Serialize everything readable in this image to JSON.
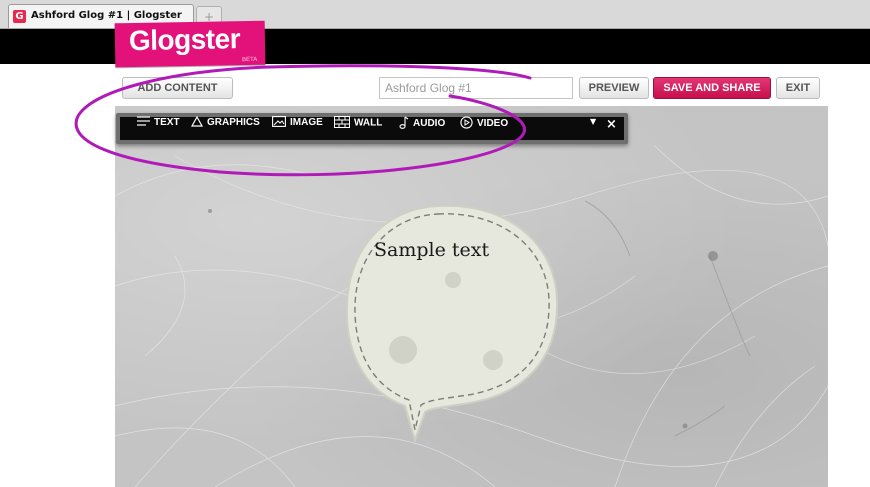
{
  "browser": {
    "tab_title": "Ashford Glog #1 | Glogster",
    "favicon_letter": "G",
    "new_tab_symbol": "+"
  },
  "logo": {
    "text": "Glogster",
    "beta": "BETA",
    "color": "#e3127a"
  },
  "toolbar": {
    "add_content_label": "ADD CONTENT",
    "title_value": "Ashford Glog #1",
    "preview_label": "PREVIEW",
    "save_label": "SAVE AND SHARE",
    "exit_label": "EXIT"
  },
  "menu": {
    "items": [
      {
        "label": "TEXT",
        "icon": "text-lines-icon"
      },
      {
        "label": "GRAPHICS",
        "icon": "triangle-icon"
      },
      {
        "label": "IMAGE",
        "icon": "image-icon"
      },
      {
        "label": "WALL",
        "icon": "wall-icon"
      },
      {
        "label": "AUDIO",
        "icon": "music-note-icon"
      },
      {
        "label": "VIDEO",
        "icon": "play-circle-icon"
      }
    ],
    "collapse_symbol": "▼",
    "close_symbol": "×"
  },
  "canvas": {
    "bubble_text": "Sample text"
  },
  "colors": {
    "accent": "#e3127a",
    "save_button": "#d11a5a",
    "annotation": "#b01ab8",
    "menu_bg": "#0b0b0b"
  }
}
